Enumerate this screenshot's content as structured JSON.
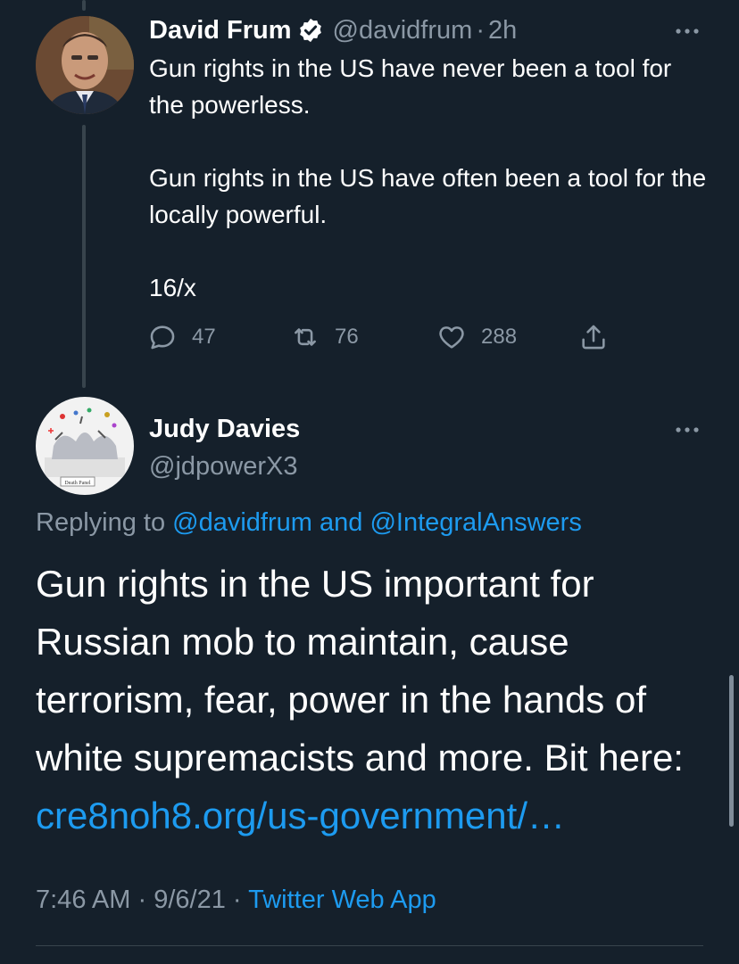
{
  "tweet1": {
    "author_name": "David Frum",
    "handle": "@davidfrum",
    "separator": "·",
    "time": "2h",
    "paragraphs": [
      "Gun rights in the US have never been a tool for the powerless.",
      "Gun rights in the US have often been a tool for the locally powerful.",
      "16/x"
    ],
    "replies": "47",
    "retweets": "76",
    "likes": "288"
  },
  "tweet2": {
    "author_name": "Judy Davies",
    "handle": "@jdpowerX3",
    "avatar_caption": "Death Panel",
    "replying_prefix": "Replying to",
    "replying_user1": "@davidfrum",
    "replying_and": "and",
    "replying_user2": "@IntegralAnswers",
    "text": "Gun rights in the US important for Russian mob to maintain, cause terrorism, fear, power in the hands of white supremacists and more. Bit here:",
    "link": "cre8noh8.org/us-government/…",
    "time": "7:46 AM",
    "date": "9/6/21",
    "separator": "·",
    "app": "Twitter Web App"
  },
  "colors": {
    "background": "#15202b",
    "text_primary": "#ffffff",
    "text_secondary": "#8b98a5",
    "accent": "#1d9bf0",
    "divider": "#38444d"
  },
  "icons": {
    "verified": "verified-badge-icon",
    "more": "more-horizontal-icon",
    "reply": "reply-icon",
    "retweet": "retweet-icon",
    "like": "heart-icon",
    "share": "share-icon"
  }
}
